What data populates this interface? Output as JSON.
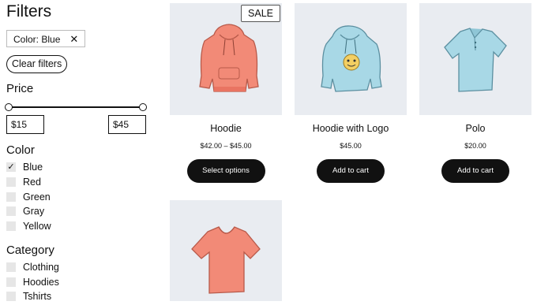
{
  "filters": {
    "title": "Filters",
    "active_chip": "Color: Blue",
    "clear_label": "Clear filters",
    "price": {
      "title": "Price",
      "min": "$15",
      "max": "$45"
    },
    "color": {
      "title": "Color",
      "items": [
        {
          "label": "Blue",
          "checked": true
        },
        {
          "label": "Red",
          "checked": false
        },
        {
          "label": "Green",
          "checked": false
        },
        {
          "label": "Gray",
          "checked": false
        },
        {
          "label": "Yellow",
          "checked": false
        }
      ]
    },
    "category": {
      "title": "Category",
      "items": [
        {
          "label": "Clothing"
        },
        {
          "label": "Hoodies"
        },
        {
          "label": "Tshirts"
        }
      ]
    }
  },
  "products": [
    {
      "name": "Hoodie",
      "price": "$42.00 – $45.00",
      "button": "Select options",
      "badge": "SALE",
      "image": "hoodie-red-icon"
    },
    {
      "name": "Hoodie with Logo",
      "price": "$45.00",
      "button": "Add to cart",
      "image": "hoodie-blue-logo-icon"
    },
    {
      "name": "Polo",
      "price": "$20.00",
      "button": "Add to cart",
      "image": "polo-blue-icon"
    },
    {
      "image": "tshirt-red-icon"
    }
  ],
  "colors": {
    "button_bg": "#111111",
    "image_bg": "#e9ecf1",
    "red_garment": "#f28a77",
    "blue_garment": "#a8d8e6"
  }
}
